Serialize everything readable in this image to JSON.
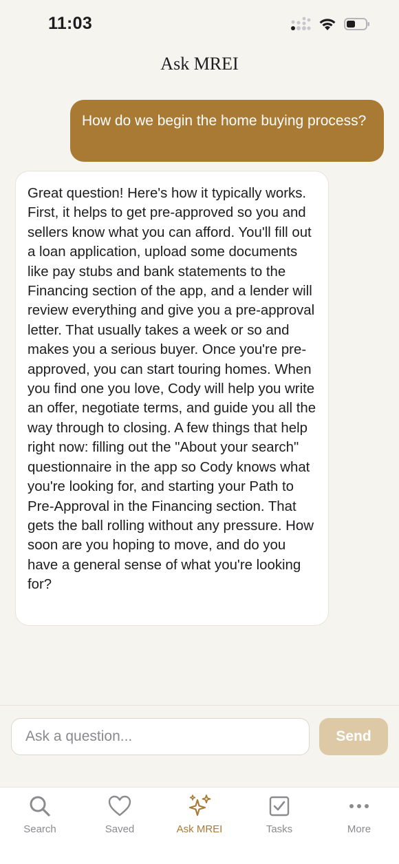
{
  "status_bar": {
    "time": "11:03"
  },
  "header": {
    "title": "Ask MREI"
  },
  "chat": {
    "messages": [
      {
        "role": "user",
        "text": "How do we begin the home buying process?"
      },
      {
        "role": "assistant",
        "text": "Great question! Here's how it typically works. First, it helps to get pre-approved so you and sellers know what you can afford. You'll fill out a loan application, upload some documents like pay stubs and bank statements to the Financing section of the app, and a lender will review everything and give you a pre-approval letter. That usually takes a week or so and makes you a serious buyer. Once you're pre-approved, you can start touring homes. When you find one you love, Cody will help you write an offer, negotiate terms, and guide you all the way through to closing. A few things that help right now: filling out the \"About your search\" questionnaire in the app so Cody knows what you're looking for, and starting your Path to Pre-Approval in the Financing section. That gets the ball rolling without any pressure. How soon are you hoping to move, and do you have a general sense of what you're looking for?"
      }
    ]
  },
  "composer": {
    "placeholder": "Ask a question...",
    "value": "",
    "send_label": "Send"
  },
  "tab_bar": {
    "items": [
      {
        "label": "Search",
        "icon": "search-icon",
        "active": false
      },
      {
        "label": "Saved",
        "icon": "heart-icon",
        "active": false
      },
      {
        "label": "Ask MREI",
        "icon": "sparkles-icon",
        "active": true
      },
      {
        "label": "Tasks",
        "icon": "checkbox-icon",
        "active": false
      },
      {
        "label": "More",
        "icon": "ellipsis-icon",
        "active": false
      }
    ]
  },
  "colors": {
    "accent": "#a97a34",
    "send_disabled": "#ddc9a6",
    "background": "#f6f4ef",
    "inactive_tab": "#8b8b8f"
  }
}
